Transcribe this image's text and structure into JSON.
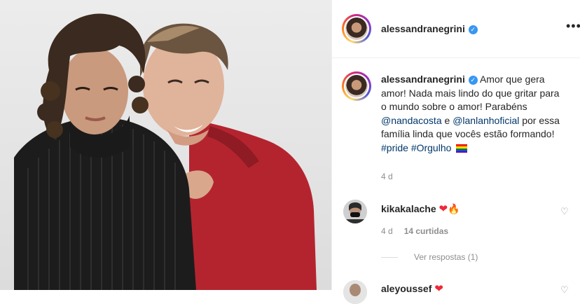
{
  "post": {
    "author": "alessandranegrini",
    "verified_glyph": "✓",
    "more_glyph": "•••",
    "caption": {
      "part1": "Amor que gera amor! Nada mais lindo do que gritar para o mundo sobre o amor! Parabéns",
      "mention1": "@nandacosta",
      "part2": "e",
      "mention2": "@lanlanhoficial",
      "part3": "por essa família linda que vocês estão formando!",
      "tag1": "#pride",
      "tag2": "#Orgulho",
      "emoji": "pride-flag"
    },
    "time": "4 d"
  },
  "comments": [
    {
      "user": "kikakalache",
      "heart": "❤",
      "fire": "🔥",
      "time": "4 d",
      "likes": "14 curtidas",
      "replies": "Ver respostas (1)"
    },
    {
      "user": "aleyoussef",
      "heart": "❤"
    }
  ],
  "colors": {
    "link": "#00376b",
    "verified": "#3897f0",
    "muted": "#8e8e8e",
    "heart": "#ed2939"
  }
}
